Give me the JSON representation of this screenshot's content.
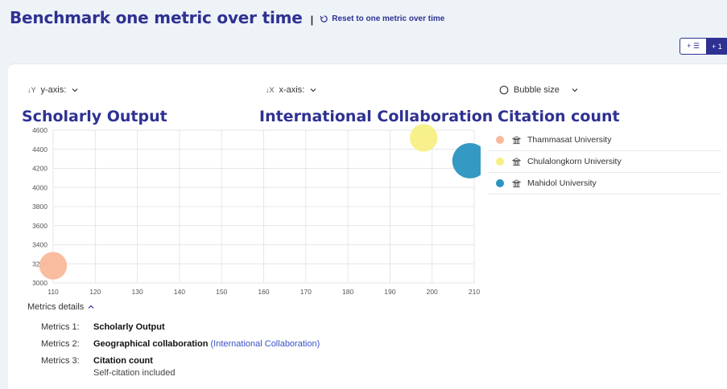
{
  "header": {
    "title": "Benchmark one metric over time",
    "separator": "|",
    "reset_label": "Reset to one metric over time"
  },
  "top_right": {
    "button1_label": "+ ☰",
    "button2_label": "+ 1"
  },
  "selectors": {
    "y_axis_label": "y-axis:",
    "x_axis_label": "x-axis:",
    "bubble_label": "Bubble size"
  },
  "metrics": {
    "y": "Scholarly Output",
    "x": "International Collaboration",
    "bubble": "Citation count"
  },
  "legend": [
    {
      "name": "Thammasat University",
      "color": "#f9b99a"
    },
    {
      "name": "Chulalongkorn University",
      "color": "#f7ef85"
    },
    {
      "name": "Mahidol University",
      "color": "#2a95c0"
    }
  ],
  "chart_data": {
    "type": "scatter",
    "xlim": [
      110,
      210
    ],
    "ylim": [
      3000,
      4600
    ],
    "x_ticks": [
      110,
      120,
      130,
      140,
      150,
      160,
      170,
      180,
      190,
      200,
      210
    ],
    "y_ticks": [
      3000,
      3200,
      3400,
      3600,
      3800,
      4000,
      4200,
      4400,
      4600
    ],
    "grid": true,
    "series": [
      {
        "name": "Thammasat University",
        "x": 110,
        "y": 3180,
        "size": 0.78,
        "color": "#f9b99a"
      },
      {
        "name": "Chulalongkorn University",
        "x": 198,
        "y": 4520,
        "size": 0.78,
        "color": "#f7ef85"
      },
      {
        "name": "Mahidol University",
        "x": 209,
        "y": 4280,
        "size": 1.0,
        "color": "#2a95c0"
      }
    ]
  },
  "details": {
    "toggle_label": "Metrics details",
    "rows": [
      {
        "key": "Metrics 1:",
        "value": "Scholarly Output",
        "link": "",
        "sub": ""
      },
      {
        "key": "Metrics 2:",
        "value": "Geographical collaboration",
        "link": "(International Collaboration)",
        "sub": ""
      },
      {
        "key": "Metrics 3:",
        "value": "Citation count",
        "link": "",
        "sub": "Self-citation included"
      }
    ]
  }
}
